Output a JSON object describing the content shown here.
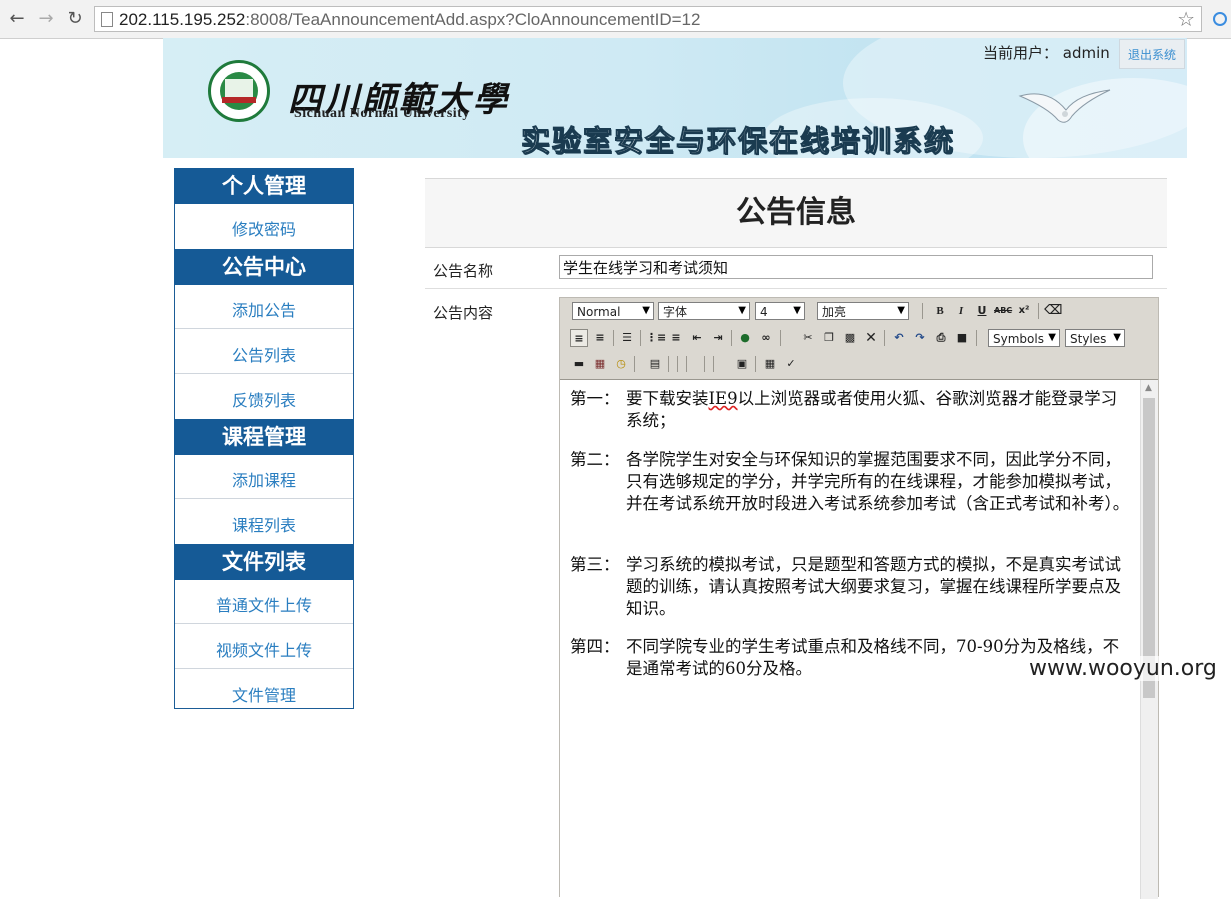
{
  "browser": {
    "url_host": "202.115.195.252",
    "url_rest": ":8008/TeaAnnouncementAdd.aspx?CloAnnouncementID=12"
  },
  "header": {
    "university_cn": "四川師範大學",
    "university_en": "Sichuan Normal University",
    "system_title": "实验室安全与环保在线培训系统",
    "current_user_label": "当前用户：",
    "current_user": "admin",
    "logout_label": "退出系统"
  },
  "sidebar": {
    "sections": [
      {
        "title": "个人管理",
        "items": [
          "修改密码"
        ]
      },
      {
        "title": "公告中心",
        "items": [
          "添加公告",
          "公告列表",
          "反馈列表"
        ]
      },
      {
        "title": "课程管理",
        "items": [
          "添加课程",
          "课程列表"
        ]
      },
      {
        "title": "文件列表",
        "items": [
          "普通文件上传",
          "视频文件上传",
          "文件管理"
        ]
      }
    ]
  },
  "main": {
    "title": "公告信息",
    "name_label": "公告名称",
    "name_value": "学生在线学习和考试须知",
    "content_label": "公告内容"
  },
  "editor": {
    "format": "Normal",
    "font": "字体",
    "size": "4",
    "style": "加亮",
    "symbols": "Symbols",
    "styles": "Styles",
    "paragraphs": [
      {
        "label": "第一：",
        "text_pre": "要下载安装",
        "text_ie9": "IE9",
        "text_post": "以上浏览器或者使用火狐、谷歌浏览器才能登录学习系统；"
      },
      {
        "label": "第二：",
        "text": "各学院学生对安全与环保知识的掌握范围要求不同，因此学分不同，只有选够规定的学分，并学完所有的在线课程，才能参加模拟考试，并在考试系统开放时段进入考试系统参加考试（含正式考试和补考）。"
      },
      {
        "label": "第三：",
        "text": "学习系统的模拟考试，只是题型和答题方式的模拟，不是真实考试试题的训练，请认真按照考试大纲要求复习，掌握在线课程所学要点及知识。"
      },
      {
        "label": "第四：",
        "text": "不同学院专业的学生考试重点和及格线不同，70-90分为及格线，不是通常考试的60分及格。"
      }
    ]
  },
  "watermark": "www.wooyun.org"
}
